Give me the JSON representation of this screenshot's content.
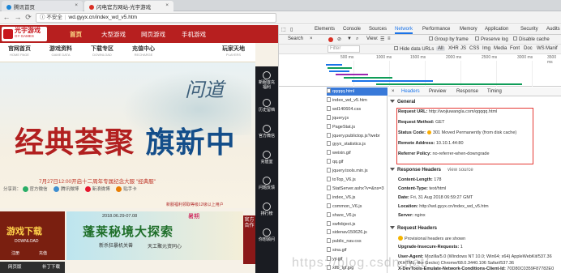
{
  "browser": {
    "tabs": [
      {
        "title": "腾讯首页",
        "favicon_color": "#1b85d6"
      },
      {
        "title": "闪电官方网站-光宇游戏",
        "favicon_color": "#d93025"
      }
    ],
    "nav": {
      "back": "←",
      "forward": "→",
      "reload": "⟳"
    },
    "address": {
      "security": "不安全",
      "url": "wd.gyyx.cn/index_wd_v5.htm"
    }
  },
  "site": {
    "logo": {
      "cn": "光宇游戏",
      "en": "GY GAMES"
    },
    "main_nav": [
      "首页",
      "大型游戏",
      "网页游戏",
      "手机游戏"
    ],
    "sub_nav": [
      {
        "cn": "官网首页",
        "en": "HOME PAGE"
      },
      {
        "cn": "游戏资料",
        "en": "GAME DATA"
      },
      {
        "cn": "下载专区",
        "en": "DOWNLOAD"
      },
      {
        "cn": "充值中心",
        "en": "RECHARGE"
      },
      {
        "cn": "玩家天地",
        "en": "PLAYERS"
      }
    ],
    "hero": {
      "big_title_a": "经典荟聚",
      "big_title_b": "旗新中",
      "logo_text": "问道",
      "date_line": "7月27日12:00开启十二周年专属纪念大服 \"经典服\"",
      "share_label": "分享到：",
      "share": [
        {
          "label": "官方微信",
          "color": "#2aae67"
        },
        {
          "label": "腾讯微博",
          "color": "#3e8ed0"
        },
        {
          "label": "新浪微博",
          "color": "#e6162d"
        },
        {
          "label": "贴手卡",
          "color": "#e87e04"
        }
      ],
      "fine_print": "新服福利领取等级12级以上用户"
    },
    "right_rail": [
      "新服首充福利",
      "历史留档",
      "官方微信",
      "充值室",
      "问题反馈",
      "排行榜",
      "你想顾问"
    ],
    "download": {
      "title": "游戏下载",
      "sub": "DOWNLOAD",
      "btn1": "注册",
      "btn2": "充值"
    },
    "banner": {
      "date": "2018.06.29-07.08",
      "tag": "暑期",
      "title": "蓬莱秘境大探索",
      "line1": "新杀狂暴机关兽",
      "line2": "天工聚元资同心"
    },
    "promo_col": "官方合作",
    "bottom_bar": [
      "网页版",
      "补丁下载"
    ]
  },
  "devtools": {
    "tabs": [
      "Elements",
      "Console",
      "Sources",
      "Network",
      "Performance",
      "Memory",
      "Application",
      "Security",
      "Audits"
    ],
    "selected_tab": "Network",
    "toolbar": {
      "view": "View:",
      "group": "Group by frame",
      "preserve": "Preserve log",
      "disable": "Disable cache"
    },
    "filter": {
      "placeholder": "Filter",
      "hide_data": "Hide data URLs",
      "types": [
        "All",
        "XHR",
        "JS",
        "CSS",
        "Img",
        "Media",
        "Font",
        "Doc",
        "WS",
        "Manif"
      ],
      "selected": "All"
    },
    "timeline_ticks": [
      "500 ms",
      "1000 ms",
      "1500 ms",
      "2000 ms",
      "2500 ms",
      "3000 ms",
      "3500 ms"
    ],
    "requests": [
      "qqqqq.html",
      "index_wd_v5.htm",
      "wd140604.css",
      "jquery.js",
      "PageStat.js",
      "jquery.publictop.js?webr",
      "gyyx_statistics.js",
      "weixin.gif",
      "qq.gif",
      "jquery.tools.min.js",
      "toTop_V6.js",
      "StatServer.ashx?v=&ns=3",
      "index_V6.js",
      "common_V6.js",
      "share_V6.js",
      "swfobject.js",
      "sidenav150626.js",
      "public_nav.css",
      "sina.gif",
      "yy.gif",
      "xlfb_lgf.jpg"
    ],
    "selected_request": "qqqqq.html",
    "detail_tabs": [
      "Headers",
      "Preview",
      "Response",
      "Timing"
    ],
    "general": {
      "title": "General",
      "rows": [
        {
          "k": "Request URL:",
          "v": "http://wojiuwangla.com/qqqqq.html"
        },
        {
          "k": "Request Method:",
          "v": "GET"
        },
        {
          "k": "Status Code:",
          "v": "301 Moved Permanently (from disk cache)"
        },
        {
          "k": "Remote Address:",
          "v": "10.10.1.44:80"
        },
        {
          "k": "Referrer Policy:",
          "v": "no-referrer-when-downgrade"
        }
      ]
    },
    "response_headers": {
      "title": "Response Headers",
      "view_source": "view source",
      "rows": [
        {
          "k": "Content-Length:",
          "v": "178"
        },
        {
          "k": "Content-Type:",
          "v": "text/html"
        },
        {
          "k": "Date:",
          "v": "Fri, 31 Aug 2018 06:59:27 GMT"
        },
        {
          "k": "Location:",
          "v": "http://wd.gyyx.cn/index_wd_v5.htm"
        },
        {
          "k": "Server:",
          "v": "nginx"
        }
      ]
    },
    "request_headers": {
      "title": "Request Headers",
      "warning": "Provisional headers are shown",
      "rows": [
        {
          "k": "Upgrade-Insecure-Requests:",
          "v": "1"
        },
        {
          "k": "User-Agent:",
          "v": "Mozilla/5.0 (Windows NT 10.0; Win64; x64) AppleWebKit/537.36 (KHTML, like Gecko) Chrome/68.0.3440.106 Safari/537.36"
        },
        {
          "k": "X-DevTools-Emulate-Network-Conditions-Client-Id:",
          "v": "70D80C0359F87782E0"
        }
      ],
      "ua_cont": ", like Gecko) Chrome/68.0.3440.106 Safari/537.36"
    }
  },
  "watermark": "https://blog.csdn.net/",
  "colors": {
    "brand_red": "#b71f1f",
    "devtools_blue": "#1a73e8",
    "highlight": "#e53935"
  }
}
